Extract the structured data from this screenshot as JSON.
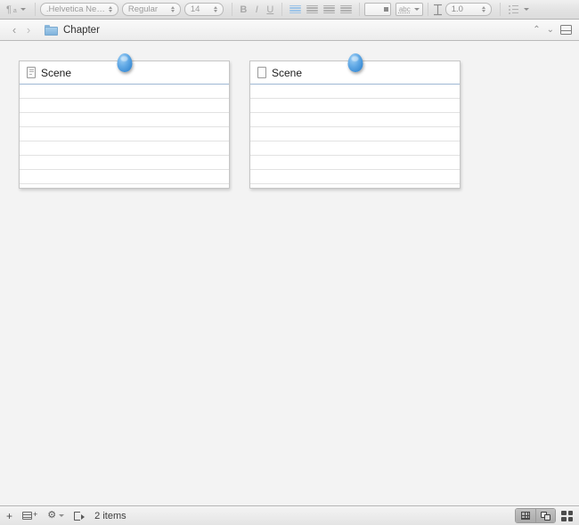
{
  "format_toolbar": {
    "paragraph_style_label": "¶",
    "paragraph_sub_label": "a",
    "font_family": ".Helvetica Neue...",
    "font_style": "Regular",
    "font_size": "14",
    "bold_label": "B",
    "italic_label": "I",
    "underline_label": "U",
    "spellcheck_label": "abc",
    "line_spacing": "1.0"
  },
  "nav_bar": {
    "back_label": "‹",
    "forward_label": "›",
    "breadcrumb_title": "Chapter",
    "prev_label": "⌃",
    "next_label": "⌄"
  },
  "corkboard": {
    "cards": [
      {
        "title": "Scene",
        "icon": "document-lined-icon",
        "pin_color": "#3f8fd6"
      },
      {
        "title": "Scene",
        "icon": "document-blank-icon",
        "pin_color": "#3f8fd6"
      }
    ]
  },
  "footer": {
    "add_label": "+",
    "add_folder_label": "+",
    "gear_label": "⚙",
    "item_count": "2 items"
  },
  "colors": {
    "accent": "#3f8fd6",
    "card_title_rule": "#9fb8d4",
    "background": "#f3f3f3",
    "card_background": "#ffffff",
    "card_rule": "#e2e2e2"
  }
}
